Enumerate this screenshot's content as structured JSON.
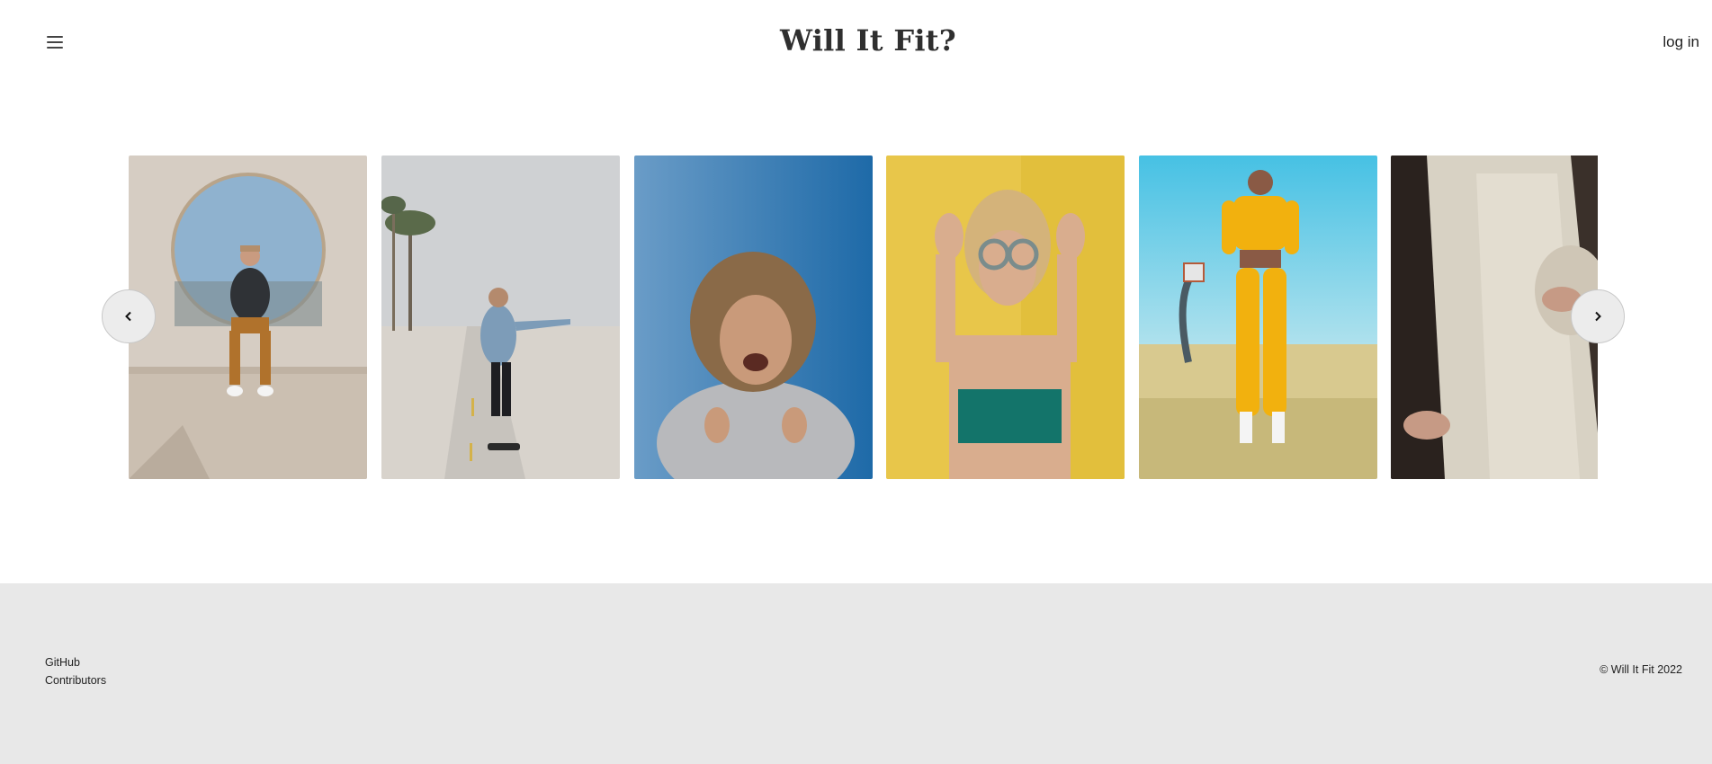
{
  "header": {
    "title": "Will It Fit?",
    "login_label": "log in",
    "menu_icon": "hamburger-menu-icon"
  },
  "carousel": {
    "prev_icon": "chevron-left-icon",
    "next_icon": "chevron-right-icon",
    "photos": [
      {
        "subject": "man sitting on wall in front of circular window"
      },
      {
        "subject": "man skateboarding on beach path"
      },
      {
        "subject": "laughing woman with curly hair on blue background"
      },
      {
        "subject": "woman with round sunglasses on yellow background"
      },
      {
        "subject": "woman in yellow tracksuit by basketball hoop"
      },
      {
        "subject": "person in cream trousers seated"
      }
    ]
  },
  "footer": {
    "links": [
      "GitHub",
      "Contributors"
    ],
    "copyright": "© Will It Fit 2022"
  },
  "colors": {
    "footer_bg": "#e8e8e8",
    "nav_button_bg": "#ececec"
  }
}
